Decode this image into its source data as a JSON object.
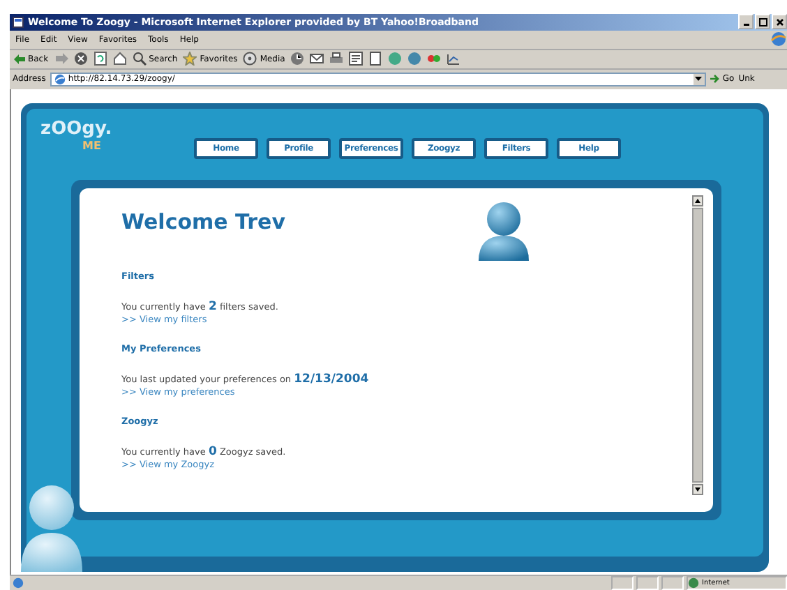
{
  "window": {
    "title": "Welcome To Zoogy - Microsoft Internet Explorer provided by BT Yahoo!Broadband"
  },
  "menu": [
    "File",
    "Edit",
    "View",
    "Favorites",
    "Tools",
    "Help"
  ],
  "toolbar": {
    "back": "Back",
    "search": "Search",
    "favorites": "Favorites",
    "media": "Media"
  },
  "address_bar": {
    "label": "Address",
    "url": "http://82.14.73.29/zoogy/",
    "go": "Go",
    "links": "Unk"
  },
  "logo": {
    "name": "zOOgy.",
    "sub": "ME"
  },
  "nav": [
    {
      "label": "Home"
    },
    {
      "label": "Profile"
    },
    {
      "label": "Preferences"
    },
    {
      "label": "Zoogyz"
    },
    {
      "label": "Filters"
    },
    {
      "label": "Help"
    }
  ],
  "heading": "Welcome Trev",
  "sections": [
    {
      "title": "Filters",
      "text": "You currently have **2**  filters saved.",
      "link": ">> View my filters"
    },
    {
      "title": "My Preferences",
      "text": "You last updated your preferences on **12/13/2004**",
      "link": ">> View my preferences"
    },
    {
      "title": "Zoogyz",
      "text": "You currently have **0**  Zoogyz saved.",
      "link": ">> View my Zoogyz"
    }
  ],
  "status_bar": {
    "zone": "Internet"
  }
}
